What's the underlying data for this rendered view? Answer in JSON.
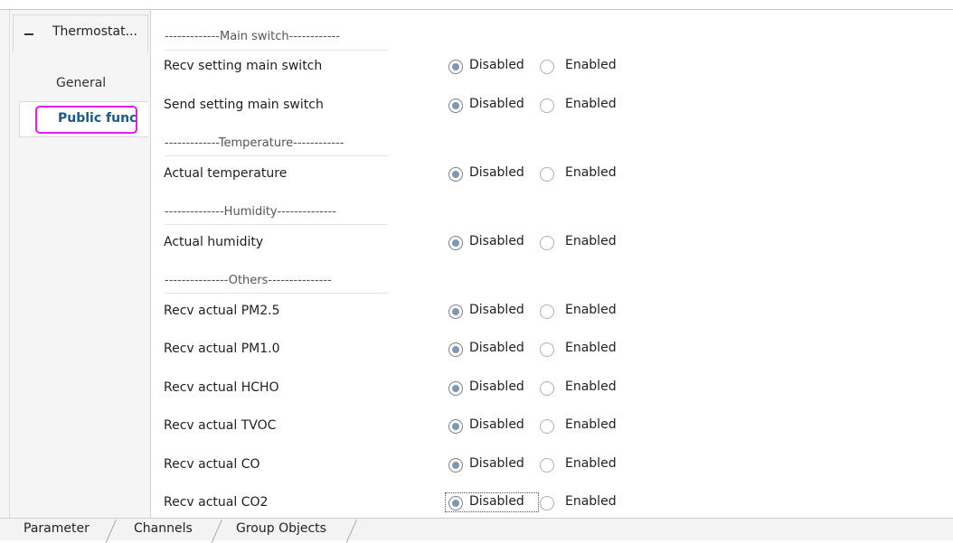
{
  "sidebar": {
    "tree_title": "Thermostat...",
    "items": [
      {
        "label": "General"
      },
      {
        "label": "Public func"
      }
    ]
  },
  "sections": {
    "main_switch": "-------------Main switch------------",
    "temperature": "-------------Temperature------------",
    "humidity": "--------------Humidity--------------",
    "others": "---------------Others---------------"
  },
  "params": [
    {
      "label": "Recv setting main switch",
      "selected": "Disabled"
    },
    {
      "label": "Send setting main switch",
      "selected": "Disabled"
    },
    {
      "label": "Actual temperature",
      "selected": "Disabled"
    },
    {
      "label": "Actual humidity",
      "selected": "Disabled"
    },
    {
      "label": "Recv actual PM2.5",
      "selected": "Disabled"
    },
    {
      "label": "Recv actual PM1.0",
      "selected": "Disabled"
    },
    {
      "label": "Recv actual HCHO",
      "selected": "Disabled"
    },
    {
      "label": "Recv actual TVOC",
      "selected": "Disabled"
    },
    {
      "label": "Recv actual CO",
      "selected": "Disabled"
    },
    {
      "label": "Recv actual CO2",
      "selected": "Disabled"
    }
  ],
  "options": {
    "disabled": "Disabled",
    "enabled": "Enabled"
  },
  "tabs": [
    {
      "label": "Parameter"
    },
    {
      "label": "Channels"
    },
    {
      "label": "Group Objects"
    }
  ],
  "colors": {
    "highlight": "#e11de8",
    "active_nav_text": "#1c5a8a",
    "radio_fill": "#7f97b0"
  }
}
